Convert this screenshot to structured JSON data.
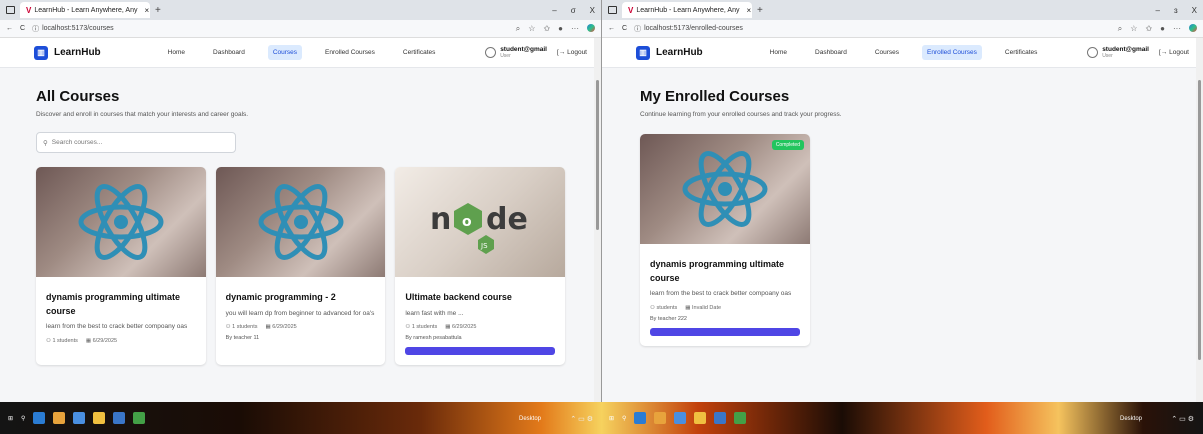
{
  "left": {
    "tab_title": "LearnHub - Learn Anywhere, Any",
    "url": "localhost:5173/courses",
    "window_controls": [
      "–",
      "σ",
      "X"
    ],
    "nav": {
      "logo": "LearnHub",
      "links": [
        "Home",
        "Dashboard",
        "Courses",
        "Enrolled Courses",
        "Certificates"
      ],
      "active": "Courses",
      "user_name": "student@gmail",
      "user_role": "User",
      "logout": "Logout"
    },
    "page": {
      "title": "All Courses",
      "subtitle": "Discover and enroll in courses that match your interests and career goals.",
      "search_placeholder": "Search courses..."
    },
    "cards": [
      {
        "title": "dynamis programming ultimate course",
        "desc": "learn from the best to crack better compoany oas",
        "students": "1 students",
        "date": "6/29/2025",
        "image": "react-logo"
      },
      {
        "title": "dynamic programming - 2",
        "desc": "you will learn dp from beginner to advanced for oa's",
        "students": "1 students",
        "date": "6/29/2025",
        "by": "By teacher 11",
        "image": "react-logo"
      },
      {
        "title": "Ultimate backend course",
        "desc": "learn fast with me ...",
        "students": "1 students",
        "date": "6/29/2025",
        "by": "By ramesh pesabattula",
        "image": "node-logo"
      }
    ]
  },
  "right": {
    "tab_title": "LearnHub - Learn Anywhere, Any",
    "url": "localhost:5173/enrolled-courses",
    "window_controls": [
      "–",
      "ɜ",
      "X"
    ],
    "nav": {
      "logo": "LearnHub",
      "links": [
        "Home",
        "Dashboard",
        "Courses",
        "Enrolled Courses",
        "Certificates"
      ],
      "active": "Enrolled Courses",
      "user_name": "student@gmail",
      "user_role": "User",
      "logout": "Logout"
    },
    "page": {
      "title": "My Enrolled Courses",
      "subtitle": "Continue learning from your enrolled courses and track your progress."
    },
    "card": {
      "badge": "Completed",
      "title": "dynamis programming ultimate course",
      "desc": "learn from the best to crack better compoany oas",
      "students": "students",
      "date": "Invalid Date",
      "by": "By teacher 222",
      "image": "react-logo"
    }
  },
  "taskbar": {
    "desktop_label": "Desktop"
  },
  "colors": {
    "accent": "#1d4ed8",
    "button": "#4f46e5",
    "badge": "#22c55e"
  }
}
